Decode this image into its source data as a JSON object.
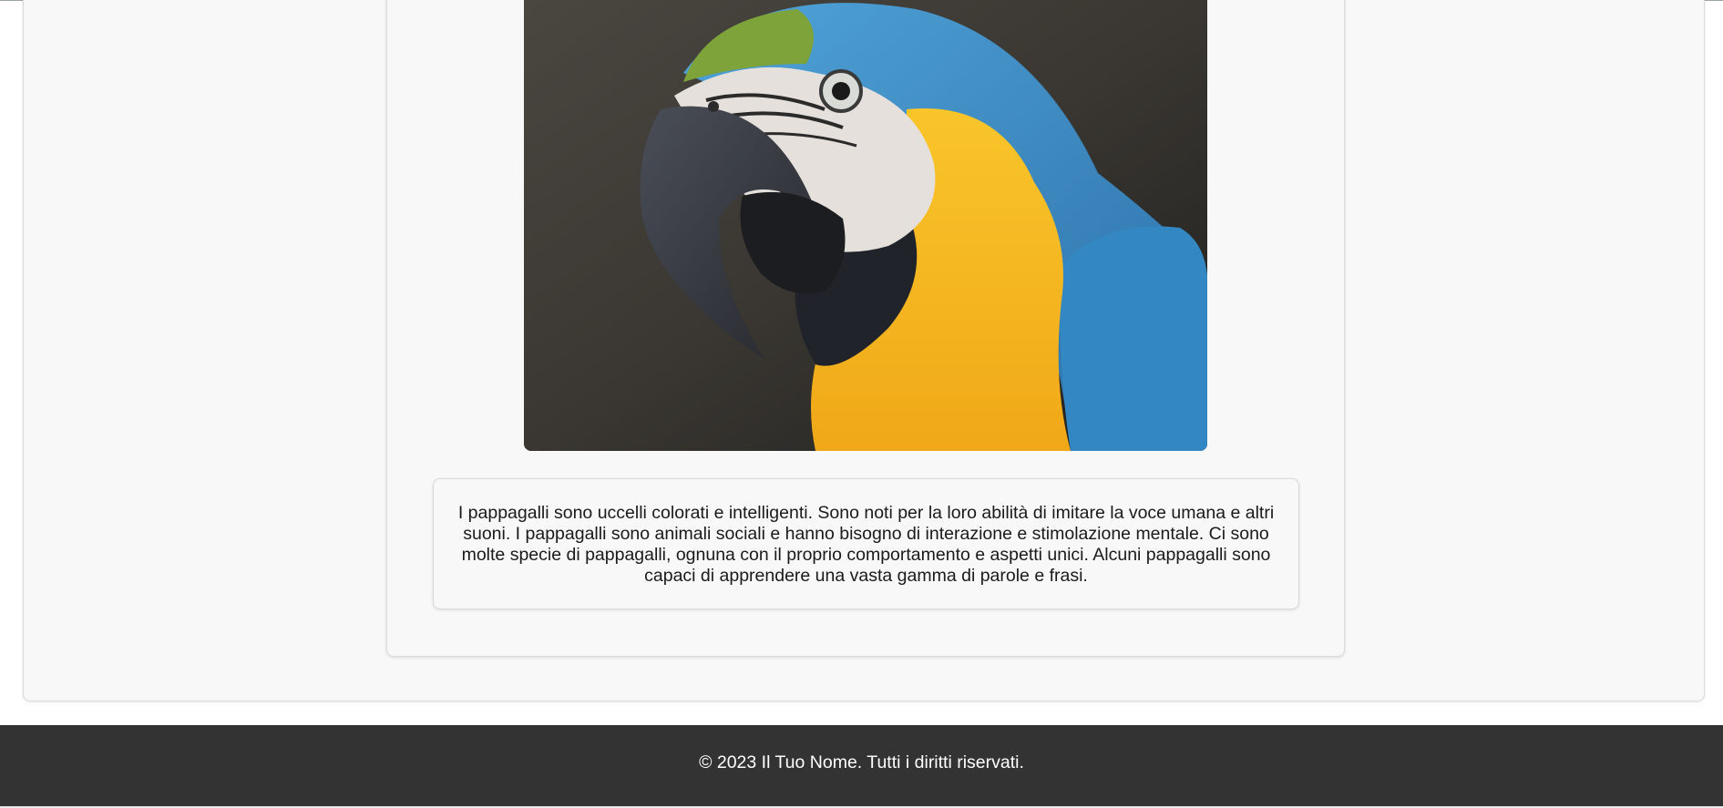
{
  "article": {
    "image": {
      "subject": "parrot",
      "colors": {
        "background": "#2b2a26",
        "blue": "#3a8cc8",
        "yellow": "#f5b820",
        "green": "#7da33a",
        "face": "#e8e2de",
        "beak": "#3a3d44"
      }
    },
    "description": "I pappagalli sono uccelli colorati e intelligenti. Sono noti per la loro abilità di imitare la voce umana e altri suoni. I pappagalli sono animali sociali e hanno bisogno di interazione e stimolazione mentale. Ci sono molte specie di pappagalli, ognuna con il proprio comportamento e aspetti unici. Alcuni pappagalli sono capaci di apprendere una vasta gamma di parole e frasi."
  },
  "footer": {
    "copyright": "© 2023 Il Tuo Nome. Tutti i diritti riservati.",
    "background_color": "#333333"
  }
}
